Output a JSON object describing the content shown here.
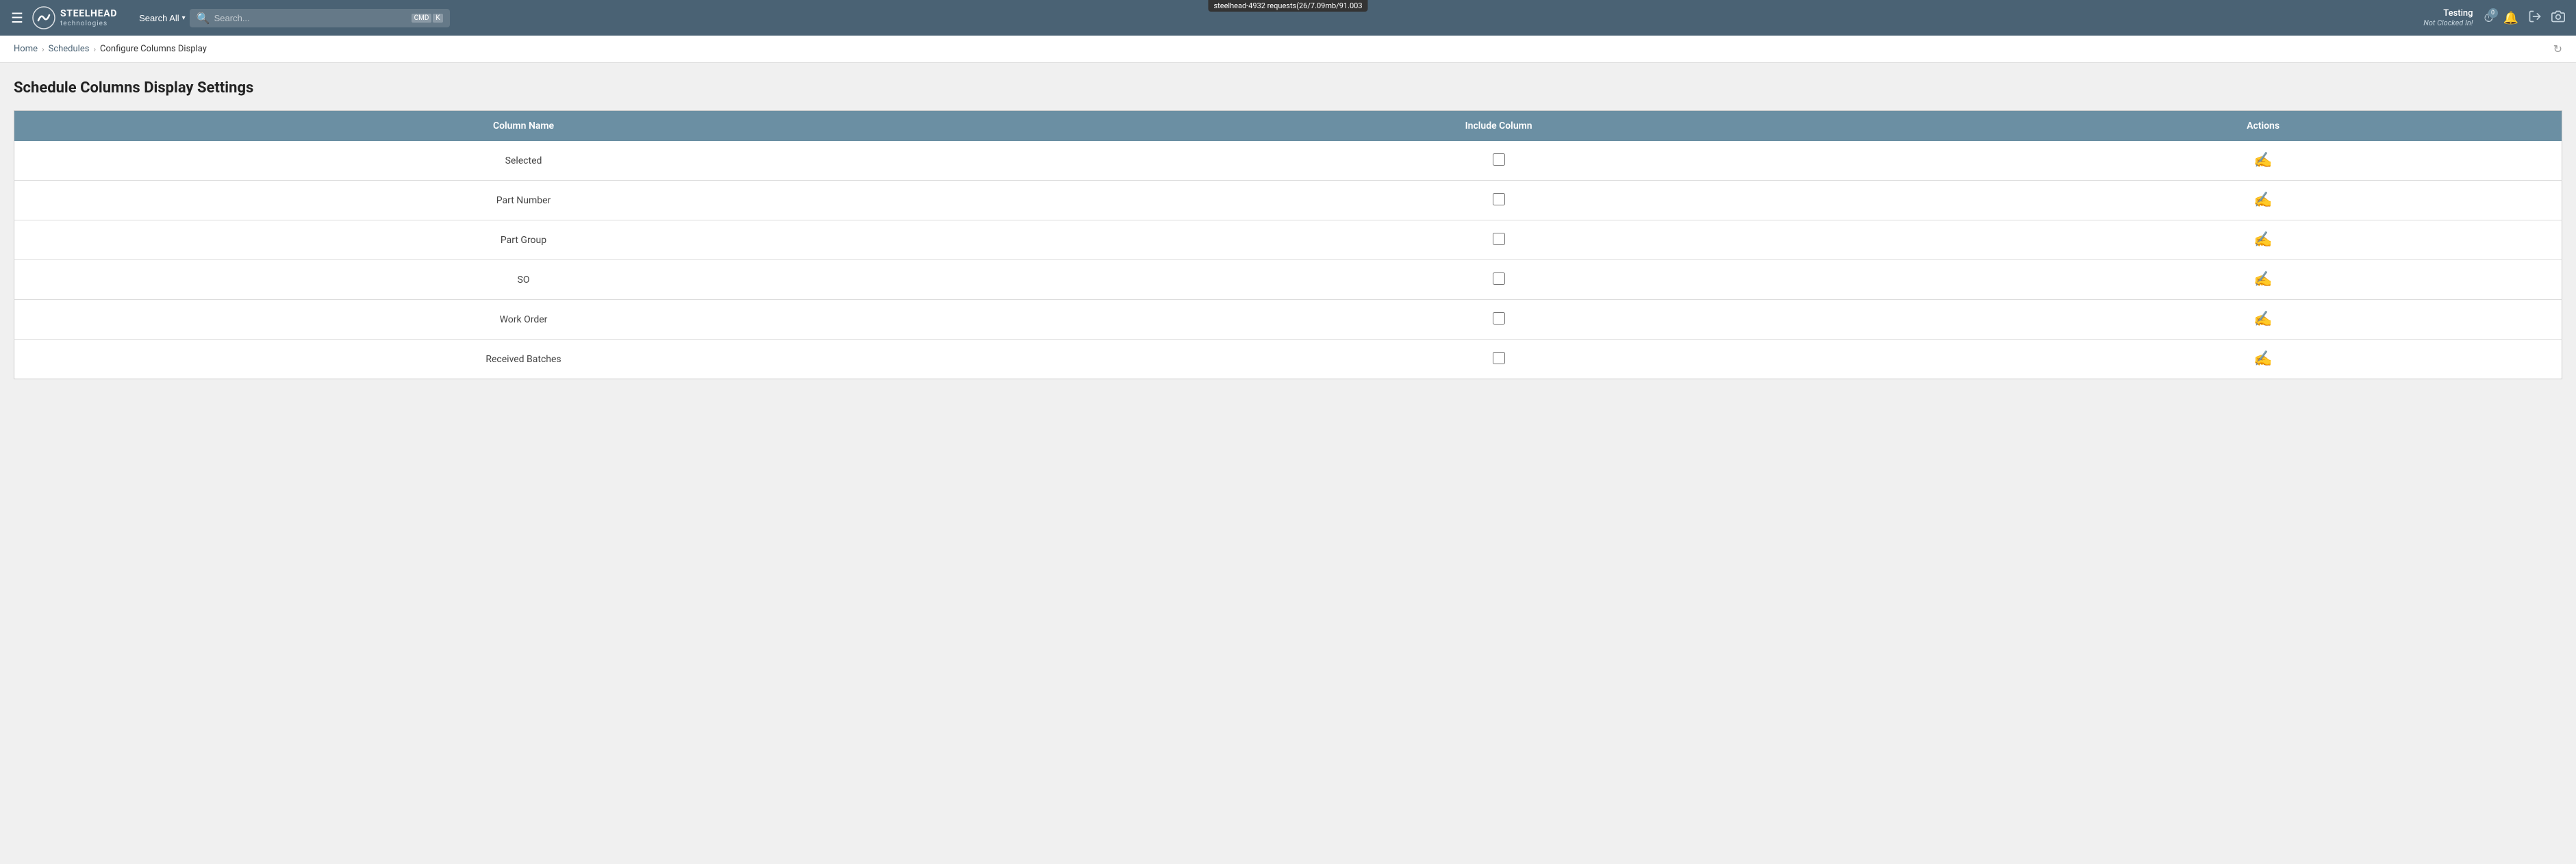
{
  "app": {
    "debug_banner": "steelhead-4932 requests(26/7.09mb/91.003"
  },
  "topnav": {
    "logo_brand": "STEELHEAD",
    "logo_sub": "technologies",
    "search_all_label": "Search All",
    "search_placeholder": "Search...",
    "kbd_cmd": "CMD",
    "kbd_k": "K",
    "user_name": "Testing",
    "user_status": "Not Clocked In!",
    "icons": {
      "clock": "🕐",
      "bell": "🔔",
      "logout": "→",
      "camera": "📷"
    }
  },
  "breadcrumb": {
    "home": "Home",
    "schedules": "Schedules",
    "current": "Configure Columns Display"
  },
  "page": {
    "title": "Schedule Columns Display Settings"
  },
  "table": {
    "headers": {
      "column_name": "Column Name",
      "include_column": "Include Column",
      "actions": "Actions"
    },
    "rows": [
      {
        "id": 1,
        "name": "Selected",
        "checked": false
      },
      {
        "id": 2,
        "name": "Part Number",
        "checked": false
      },
      {
        "id": 3,
        "name": "Part Group",
        "checked": false
      },
      {
        "id": 4,
        "name": "SO",
        "checked": false
      },
      {
        "id": 5,
        "name": "Work Order",
        "checked": false
      },
      {
        "id": 6,
        "name": "Received Batches",
        "checked": false
      }
    ]
  }
}
